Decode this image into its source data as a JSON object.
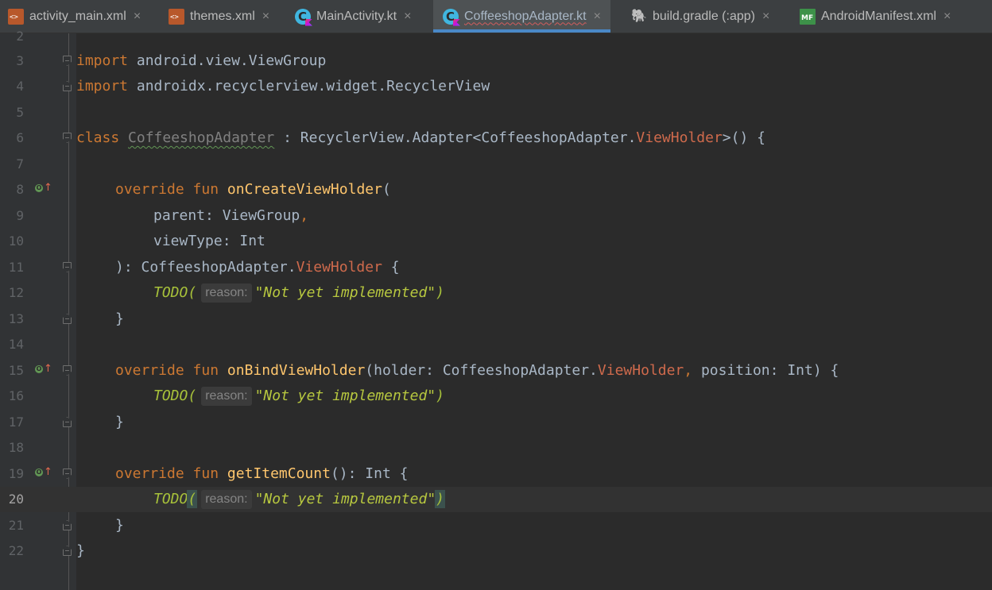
{
  "tabs": [
    {
      "label": "activity_main.xml",
      "icon": "xml-layout-icon"
    },
    {
      "label": "themes.xml",
      "icon": "xml-layout-icon"
    },
    {
      "label": "MainActivity.kt",
      "icon": "kotlin-class-icon"
    },
    {
      "label": "CoffeeshopAdapter.kt",
      "icon": "kotlin-class-icon",
      "active": true
    },
    {
      "label": "build.gradle (:app)",
      "icon": "gradle-icon"
    },
    {
      "label": "AndroidManifest.xml",
      "icon": "manifest-icon"
    }
  ],
  "close_glyph": "×",
  "editor": {
    "current_line": "20",
    "lines": [
      {
        "n": "2"
      },
      {
        "n": "3",
        "t1": "import",
        "t2": " android.view.ViewGroup"
      },
      {
        "n": "4",
        "t1": "import",
        "t2": " androidx.recyclerview.widget.RecyclerView"
      },
      {
        "n": "5"
      },
      {
        "n": "6",
        "t1": "class",
        "t2": " ",
        "t3": "CoffeeshopAdapter",
        "t4": " : RecyclerView.Adapter<CoffeeshopAdapter.",
        "t5": "ViewHolder",
        "t6": ">() {"
      },
      {
        "n": "7"
      },
      {
        "n": "8",
        "t1": "override fun",
        "t2": " ",
        "t3": "onCreateViewHolder",
        "t4": "("
      },
      {
        "n": "9",
        "t1": "parent",
        "t2": ": ViewGroup",
        "t3": ","
      },
      {
        "n": "10",
        "t1": "viewType",
        "t2": ": Int"
      },
      {
        "n": "11",
        "t1": "): CoffeeshopAdapter.",
        "t2": "ViewHolder",
        "t3": " {"
      },
      {
        "n": "12",
        "todo": "TODO(",
        "hint": "reason:",
        "str": "\"Not yet implemented\"",
        "close": ")"
      },
      {
        "n": "13",
        "t1": "}"
      },
      {
        "n": "14"
      },
      {
        "n": "15",
        "t1": "override fun",
        "t2": " ",
        "t3": "onBindViewHolder",
        "t4": "(holder: CoffeeshopAdapter.",
        "t5": "ViewHolder",
        "t6": ",",
        "t7": " position: Int) {"
      },
      {
        "n": "16",
        "todo": "TODO(",
        "hint": "reason:",
        "str": "\"Not yet implemented\"",
        "close": ")"
      },
      {
        "n": "17",
        "t1": "}"
      },
      {
        "n": "18"
      },
      {
        "n": "19",
        "t1": "override fun",
        "t2": " ",
        "t3": "getItemCount",
        "t4": "(): Int {"
      },
      {
        "n": "20",
        "todo": "TODO",
        "paren": "(",
        "hint": "reason:",
        "str": "\"Not yet implemented\"",
        "close": ")"
      },
      {
        "n": "21",
        "t1": "}"
      },
      {
        "n": "22",
        "t1": "}"
      }
    ]
  },
  "colors": {
    "background": "#2b2b2b",
    "keyword": "#cc7832",
    "function": "#ffc66d",
    "string": "#b7c73f",
    "error_type": "#cf6a4c",
    "accent": "#4a88c7"
  }
}
